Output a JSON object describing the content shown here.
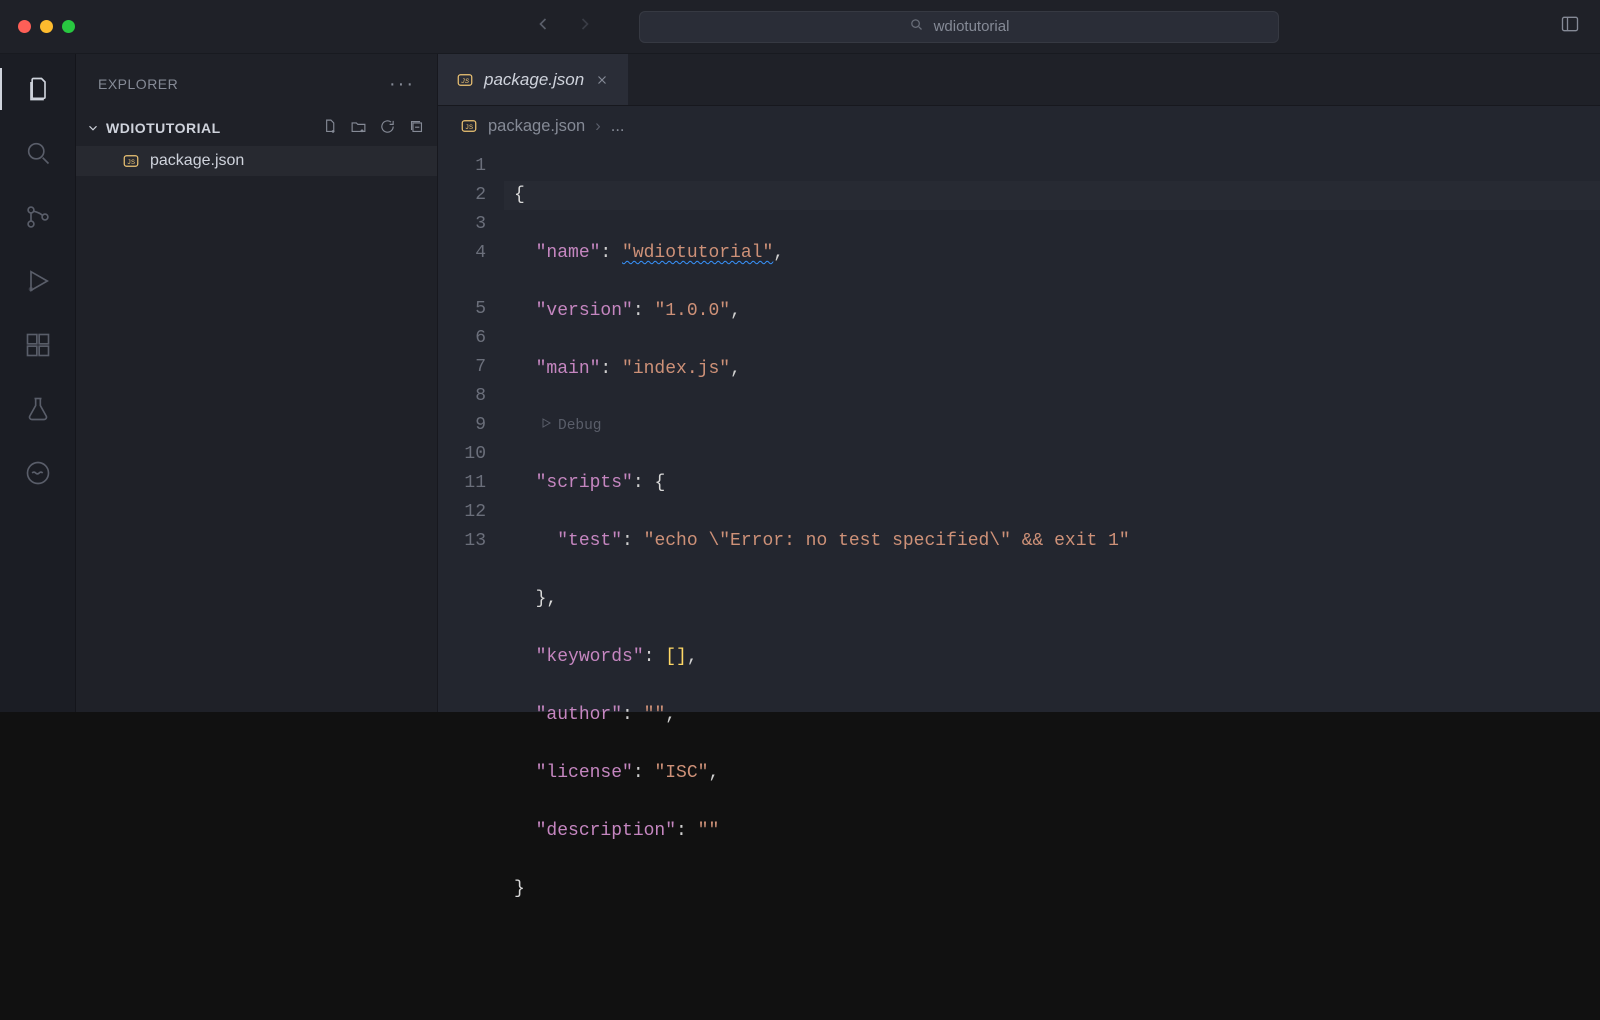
{
  "titlebar": {
    "search_text": "wdiotutorial"
  },
  "sidebar": {
    "header": "EXPLORER",
    "root": "WDIOTUTORIAL",
    "files": [
      {
        "name": "package.json"
      }
    ]
  },
  "tabs": [
    {
      "label": "package.json",
      "active": true
    }
  ],
  "breadcrumb": {
    "file": "package.json",
    "more": "..."
  },
  "codelens": {
    "debug": "Debug"
  },
  "code": {
    "line_numbers": [
      "1",
      "2",
      "3",
      "4",
      "5",
      "6",
      "7",
      "8",
      "9",
      "10",
      "11",
      "12",
      "13"
    ],
    "l1": "{",
    "l2": {
      "k": "\"name\"",
      "v": "\"wdiotutorial\""
    },
    "l3": {
      "k": "\"version\"",
      "v": "\"1.0.0\""
    },
    "l4": {
      "k": "\"main\"",
      "v": "\"index.js\""
    },
    "l5": {
      "k": "\"scripts\"",
      "v": "{"
    },
    "l6": {
      "k": "\"test\"",
      "v": "\"echo \\\"Error: no test specified\\\" && exit 1\""
    },
    "l7": "},",
    "l8": {
      "k": "\"keywords\"",
      "v": "[]"
    },
    "l9": {
      "k": "\"author\"",
      "v": "\"\""
    },
    "l10": {
      "k": "\"license\"",
      "v": "\"ISC\""
    },
    "l11": {
      "k": "\"description\"",
      "v": "\"\""
    },
    "l12": "}",
    "l13": ""
  }
}
